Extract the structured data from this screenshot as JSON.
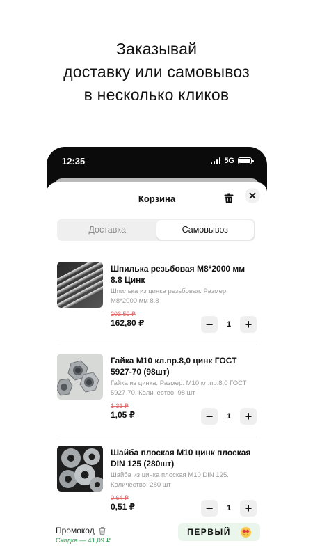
{
  "headline": {
    "lines": [
      "Заказывай",
      "доставку или самовывоз",
      "в несколько кликов"
    ]
  },
  "status_bar": {
    "time": "12:35",
    "network": "5G"
  },
  "cart": {
    "title": "Корзина",
    "tabs": [
      {
        "label": "Доставка",
        "active": false
      },
      {
        "label": "Самовывоз",
        "active": true
      }
    ],
    "items": [
      {
        "name": "Шпилька резьбовая М8*2000 мм 8.8 Цинк",
        "description": "Шпилька из цинка резьбовая. Размер: М8*2000 мм 8.8",
        "old_price": "203,50 ₽",
        "price": "162,80 ₽",
        "quantity": "1",
        "image": "threaded-rods-photo"
      },
      {
        "name": "Гайка М10 кл.пр.8,0 цинк ГОСТ 5927-70 (98шт)",
        "description": "Гайка из цинка. Размер: М10 кл.пр.8,0 ГОСТ 5927-70. Количество: 98 шт",
        "old_price": "1,31 ₽",
        "price": "1,05 ₽",
        "quantity": "1",
        "image": "hex-nuts-photo"
      },
      {
        "name": "Шайба плоская М10 цинк плоская DIN 125 (280шт)",
        "description": "Шайба из цинка плоская М10 DIN 125. Количество: 280 шт",
        "old_price": "0,64 ₽",
        "price": "0,51 ₽",
        "quantity": "1",
        "image": "flat-washers-photo"
      }
    ],
    "stepper": {
      "minus": "−",
      "plus": "+"
    },
    "promo": {
      "label": "Промокод",
      "discount": "Скидка — 41,09 ₽",
      "code": "ПЕРВЫЙ"
    }
  },
  "colors": {
    "accent_green": "#2e9e52",
    "old_price_red": "#e06a6a",
    "promo_bg": "#eaf6ec",
    "phone_frame": "#0b0b0b"
  }
}
